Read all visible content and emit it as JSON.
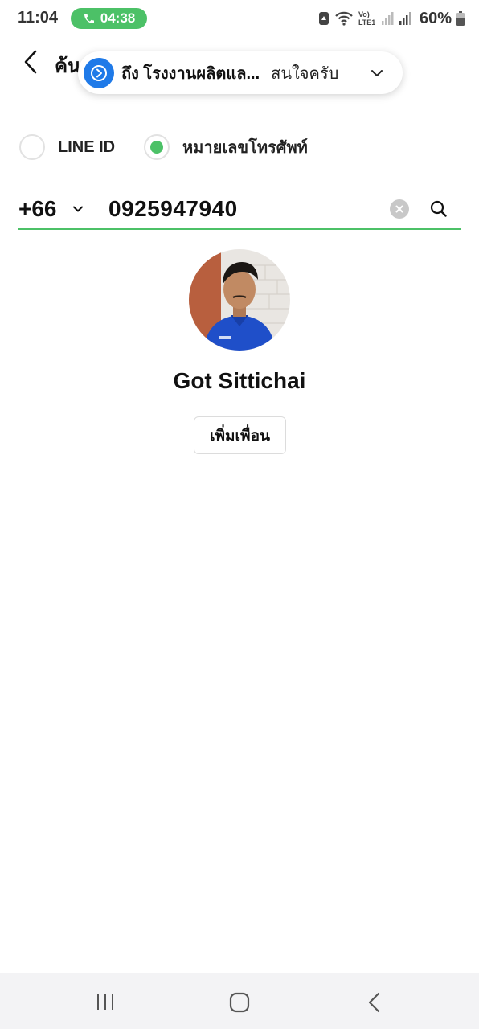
{
  "status_bar": {
    "time": "11:04",
    "call_timer": "04:38",
    "network_label": "Vo) LTE1",
    "battery": "60%"
  },
  "header": {
    "title": "ค้นหาเพื่อน"
  },
  "banner": {
    "chat_title": "ถึง โรงงานผลิตแล...",
    "message": "สนใจครับ"
  },
  "search_type": {
    "options": [
      {
        "label": "LINE ID",
        "selected": false
      },
      {
        "label": "หมายเลขโทรศัพท์",
        "selected": true
      }
    ]
  },
  "phone_input": {
    "country_code": "+66",
    "value": "0925947940"
  },
  "result": {
    "name": "Got Sittichai",
    "add_button_label": "เพิ่มเพื่อน"
  },
  "colors": {
    "accent_green": "#4cc167",
    "banner_blue": "#1f7ae8"
  },
  "icons": [
    "phone-icon",
    "back-icon",
    "chevron-down-icon",
    "clear-icon",
    "search-icon",
    "recent-apps-icon",
    "home-icon",
    "nav-back-icon"
  ]
}
